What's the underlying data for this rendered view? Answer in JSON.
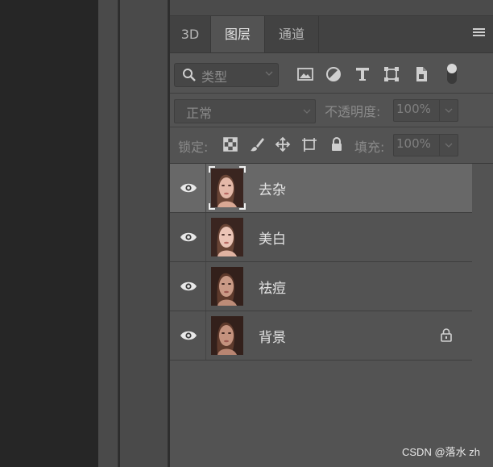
{
  "tabs": [
    {
      "label": "3D",
      "active": false
    },
    {
      "label": "图层",
      "active": true
    },
    {
      "label": "通道",
      "active": false
    }
  ],
  "panel_menu_icon": "hamburger-icon",
  "filter": {
    "kind_label": "类型",
    "icons": [
      "image-filter-icon",
      "adjustment-filter-icon",
      "type-filter-icon",
      "shape-filter-icon",
      "smart-object-filter-icon",
      "filter-toggle-icon"
    ]
  },
  "blend": {
    "mode": "正常",
    "opacity_label": "不透明度:",
    "opacity_value": "100%"
  },
  "lock": {
    "label": "锁定:",
    "icons": [
      "lock-transparent-pixels-icon",
      "lock-image-pixels-icon",
      "lock-position-icon",
      "lock-artboard-icon",
      "lock-all-icon"
    ],
    "fill_label": "填充:",
    "fill_value": "100%"
  },
  "layers": [
    {
      "name": "去杂",
      "visible": true,
      "selected": true,
      "locked": false
    },
    {
      "name": "美白",
      "visible": true,
      "selected": false,
      "locked": false
    },
    {
      "name": "祛痘",
      "visible": true,
      "selected": false,
      "locked": false
    },
    {
      "name": "背景",
      "visible": true,
      "selected": false,
      "locked": true
    }
  ],
  "watermark": "CSDN @落水 zh",
  "colors": {
    "panel_bg": "#535353",
    "selected_layer_bg": "#686868",
    "tabbar_bg": "#424242"
  }
}
